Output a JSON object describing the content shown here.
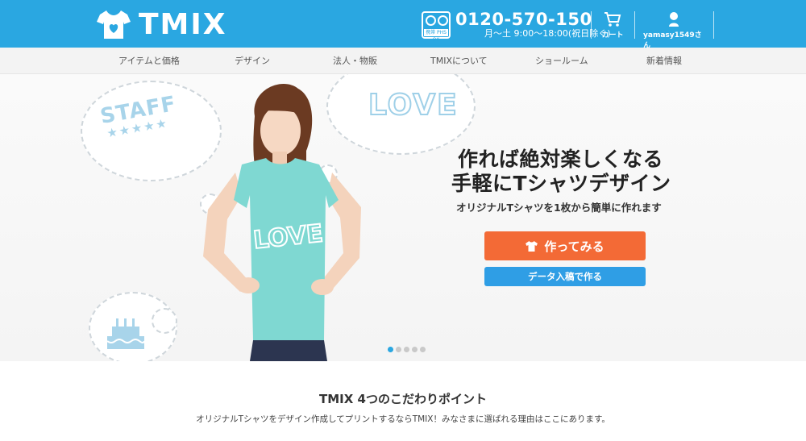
{
  "header": {
    "logo_text": "TMIX",
    "phone_number": "0120-570-150",
    "phone_hours": "月〜土 9:00〜18:00(祝日除く)",
    "freedial_label": "携帯 PHS OK",
    "cart_label": "カート",
    "user_label": "yamasy1549さん"
  },
  "nav": {
    "items": [
      {
        "label": "アイテムと価格"
      },
      {
        "label": "デザイン"
      },
      {
        "label": "法人・物販"
      },
      {
        "label": "TMIXについて"
      },
      {
        "label": "ショールーム"
      },
      {
        "label": "新着情報"
      }
    ]
  },
  "hero": {
    "staff_text": "STAFF",
    "stars": "★★★★★",
    "love_text": "LOVE",
    "shirt_love_text": "LOVE",
    "catch_line1": "作れば絶対楽しくなる",
    "catch_line2": "手軽にTシャツデザイン",
    "sub_catch": "オリジナルTシャツを1枚から簡単に作れます",
    "make_button": "作ってみる",
    "data_button": "データ入稿で作る",
    "slides_total": 5,
    "slide_active": 1
  },
  "intro": {
    "title": "TMIX 4つのこだわりポイント",
    "subtitle": "オリジナルTシャツをデザイン作成してプリントするならTMIX！みなさまに選ばれる理由はここにあります。"
  },
  "colors": {
    "brand_blue": "#2aa7e1",
    "cta_orange": "#f36a36",
    "cta_blue": "#2f9ee5",
    "shirt_mint": "#7fd8d2"
  }
}
